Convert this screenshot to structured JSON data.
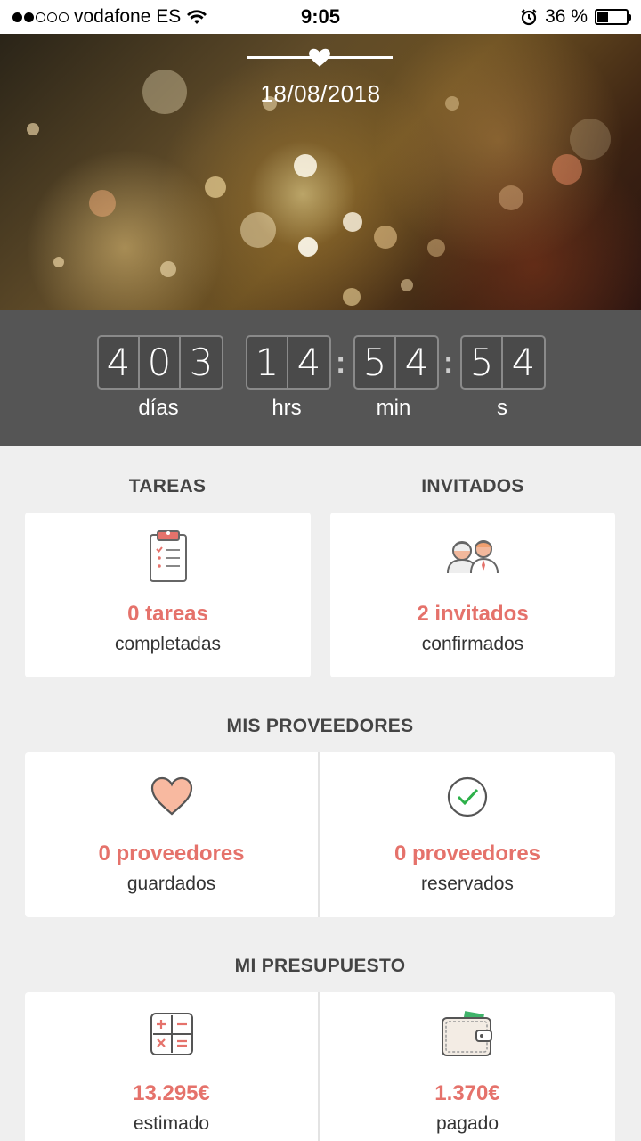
{
  "status_bar": {
    "carrier": "vodafone ES",
    "time": "9:05",
    "battery_percent": "36 %",
    "battery_level": 0.36
  },
  "hero": {
    "date": "18/08/2018"
  },
  "countdown": {
    "days": [
      "4",
      "0",
      "3"
    ],
    "hours": [
      "1",
      "4"
    ],
    "minutes": [
      "5",
      "4"
    ],
    "seconds": [
      "5",
      "4"
    ],
    "labels": {
      "days": "días",
      "hours": "hrs",
      "minutes": "min",
      "seconds": "s"
    }
  },
  "tareas": {
    "title": "TAREAS",
    "value": "0 tareas",
    "sub": "completadas"
  },
  "invitados": {
    "title": "INVITADOS",
    "value": "2 invitados",
    "sub": "confirmados"
  },
  "proveedores": {
    "title": "MIS PROVEEDORES",
    "saved_value": "0 proveedores",
    "saved_sub": "guardados",
    "booked_value": "0 proveedores",
    "booked_sub": "reservados"
  },
  "presupuesto": {
    "title": "MI PRESUPUESTO",
    "estimated_value": "13.295€",
    "estimated_sub": "estimado",
    "paid_value": "1.370€",
    "paid_sub": "pagado"
  },
  "colors": {
    "accent": "#e5726b",
    "countdown_bg": "#555555",
    "page_bg": "#efefef"
  }
}
